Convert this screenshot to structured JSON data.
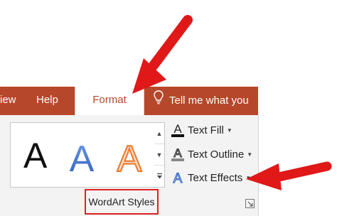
{
  "tabs": {
    "view_partial": "iew",
    "help": "Help",
    "format": "Format",
    "tell_me": "Tell me what you"
  },
  "wordart_gallery": {
    "letters": [
      "A",
      "A",
      "A"
    ],
    "letter_colors": [
      "#111111",
      "#4a7bd1",
      "#ed7d31"
    ]
  },
  "commands": {
    "text_fill": "Text Fill",
    "text_outline": "Text Outline",
    "text_effects": "Text Effects"
  },
  "group": {
    "label": "WordArt Styles"
  },
  "colors": {
    "accent": "#b7472a",
    "highlight": "#e02020",
    "ribbon_bg": "#f3f3f3"
  },
  "icons": [
    "lightbulb-icon",
    "text-fill-icon",
    "text-outline-icon",
    "text-effects-icon",
    "dialog-launcher-icon",
    "red-arrow"
  ]
}
